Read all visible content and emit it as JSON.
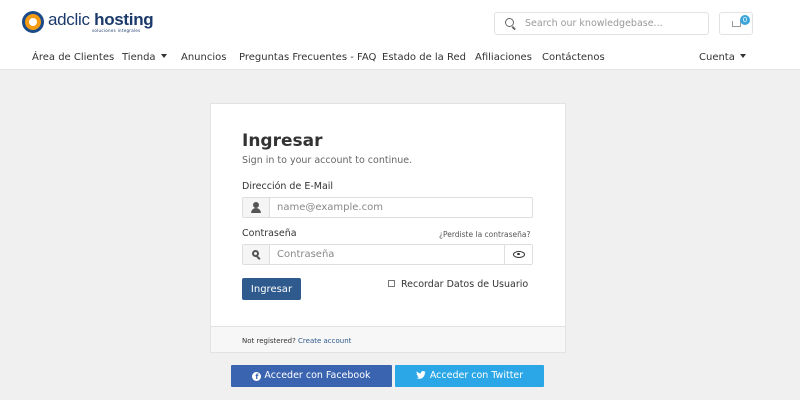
{
  "header": {
    "logo_brand_light": "adclic",
    "logo_brand_bold": "hosting",
    "logo_tagline": "soluciones integrales",
    "search_placeholder": "Search our knowledgebase...",
    "cart_count": "0"
  },
  "nav": {
    "items": [
      {
        "label": "Área de Clientes"
      },
      {
        "label": "Tienda"
      },
      {
        "label": "Anuncios"
      },
      {
        "label": "Preguntas Frecuentes - FAQ"
      },
      {
        "label": "Estado de la Red"
      },
      {
        "label": "Afiliaciones"
      },
      {
        "label": "Contáctenos"
      }
    ],
    "account_label": "Cuenta"
  },
  "login": {
    "title": "Ingresar",
    "subtitle": "Sign in to your account to continue.",
    "email_label": "Dirección de E-Mail",
    "email_placeholder": "name@example.com",
    "password_label": "Contraseña",
    "password_placeholder": "Contraseña",
    "forgot_label": "¿Perdiste la contraseña?",
    "submit_label": "Ingresar",
    "remember_label": "Recordar Datos de Usuario",
    "not_registered": "Not registered?",
    "create_account": "Create account"
  },
  "social": {
    "facebook_label": "Acceder con Facebook",
    "twitter_label": "Acceder con Twitter"
  },
  "colors": {
    "primary": "#2f5a8d",
    "facebook": "#3a63b0",
    "twitter": "#2ba6e6",
    "badge": "#3da6d9"
  }
}
